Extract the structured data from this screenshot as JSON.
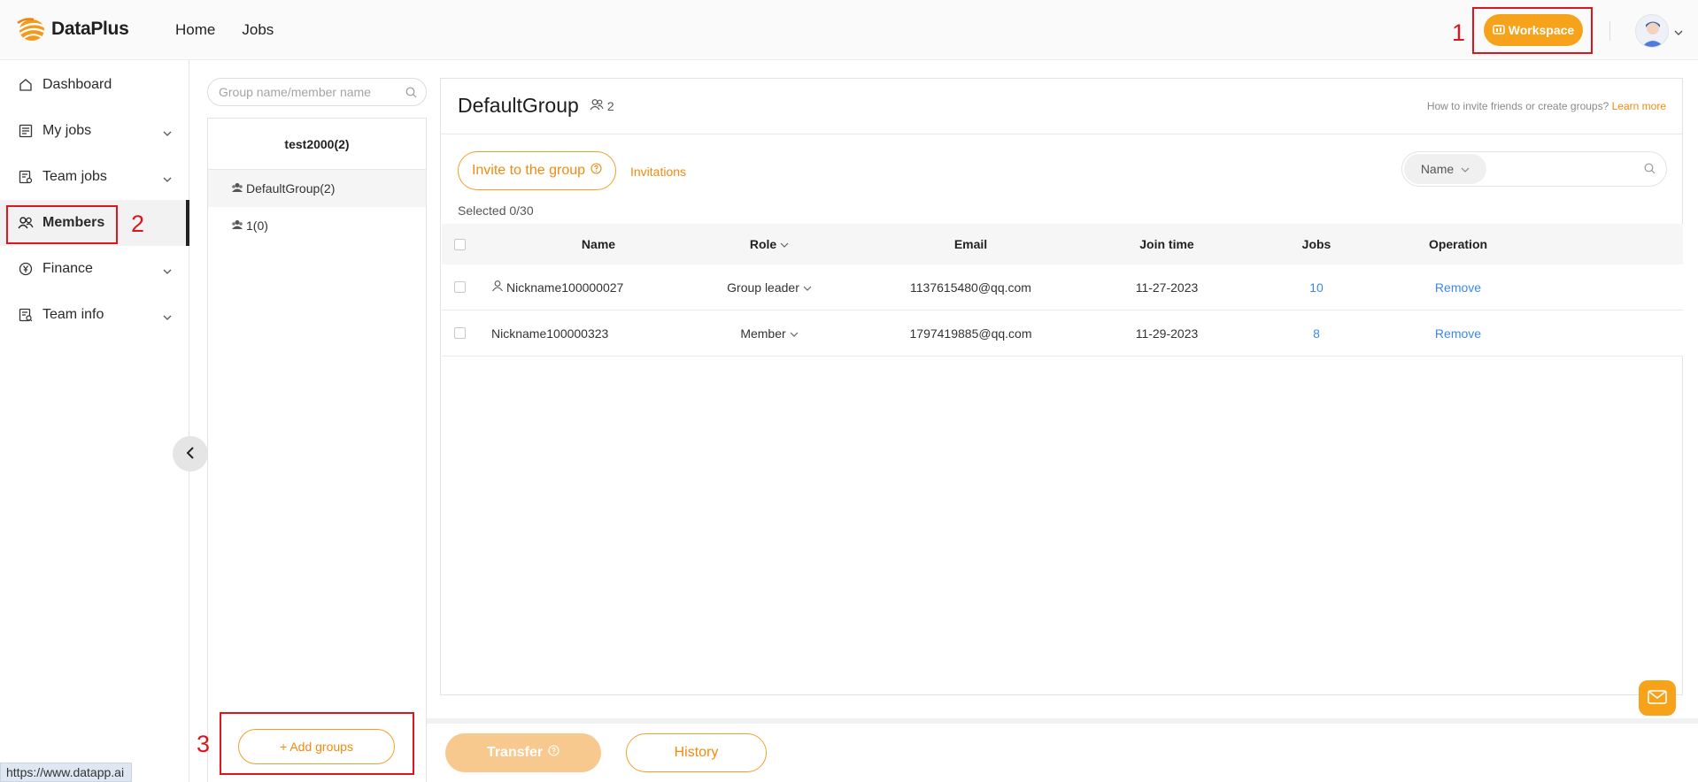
{
  "header": {
    "logo_text": "DataPlus",
    "nav": [
      "Home",
      "Jobs"
    ],
    "workspace_label": "Workspace"
  },
  "sidebar": {
    "items": [
      {
        "label": "Dashboard",
        "icon": "home-icon",
        "has_chevron": false
      },
      {
        "label": "My jobs",
        "icon": "checklist-icon",
        "has_chevron": true
      },
      {
        "label": "Team jobs",
        "icon": "team-jobs-icon",
        "has_chevron": true
      },
      {
        "label": "Members",
        "icon": "members-icon",
        "has_chevron": false,
        "active": true
      },
      {
        "label": "Finance",
        "icon": "yen-coin-icon",
        "has_chevron": true
      },
      {
        "label": "Team info",
        "icon": "team-info-icon",
        "has_chevron": true
      }
    ]
  },
  "groups": {
    "search_placeholder": "Group name/member name",
    "team_title": "test2000(2)",
    "items": [
      {
        "label": "DefaultGroup(2)",
        "active": true
      },
      {
        "label": "1(0)",
        "active": false
      }
    ],
    "add_label": "+ Add groups"
  },
  "main": {
    "group_title": "DefaultGroup",
    "member_count": "2",
    "help_text": "How to invite friends or create groups?",
    "learn_more": "Learn more",
    "invite_label": "Invite to the group",
    "invitations_label": "Invitations",
    "filter_select": "Name",
    "selected_text": "Selected 0/30",
    "columns": [
      "Name",
      "Role",
      "Email",
      "Join time",
      "Jobs",
      "Operation"
    ],
    "rows": [
      {
        "name": "Nickname100000027",
        "leader": true,
        "role": "Group leader",
        "email": "1137615480@qq.com",
        "join_time": "11-27-2023",
        "jobs": "10",
        "operation": "Remove"
      },
      {
        "name": "Nickname100000323",
        "leader": false,
        "role": "Member",
        "email": "1797419885@qq.com",
        "join_time": "11-29-2023",
        "jobs": "8",
        "operation": "Remove"
      }
    ]
  },
  "footer": {
    "transfer_label": "Transfer",
    "history_label": "History"
  },
  "annotations": [
    "1",
    "2",
    "3"
  ],
  "status_url": "https://www.datapp.ai",
  "colors": {
    "accent_orange": "#f6a21a",
    "accent_text": "#f08b10",
    "link_blue": "#3b88e6",
    "annotation_red": "#e0141b"
  }
}
